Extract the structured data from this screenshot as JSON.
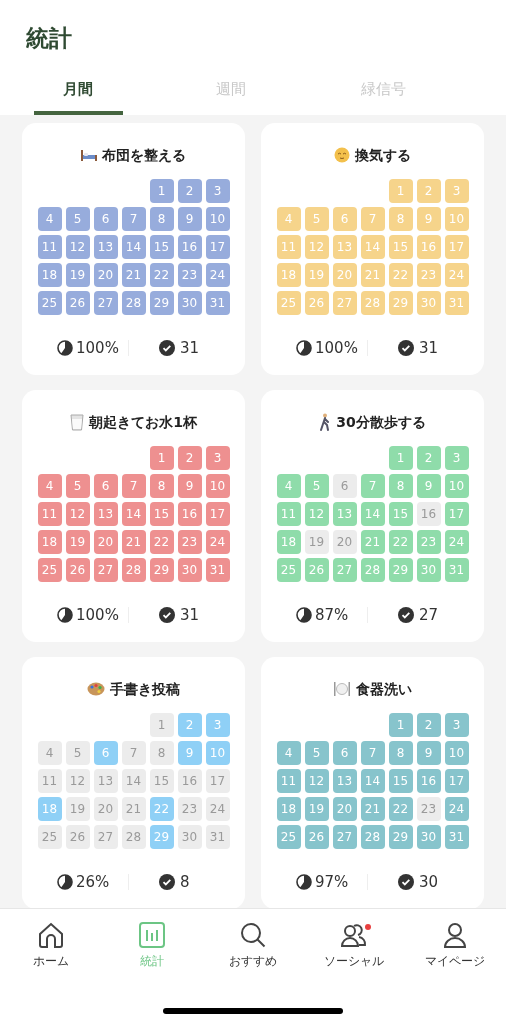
{
  "header": {
    "title": "統計"
  },
  "tabs": [
    {
      "label": "月間",
      "selected": true
    },
    {
      "label": "週間",
      "selected": false
    },
    {
      "label": "緑信号",
      "selected": false
    }
  ],
  "habits": [
    {
      "title": "布団を整える",
      "color": "#97acdc",
      "rate": "100%",
      "count": "31",
      "days": [
        {
          "label": "1",
          "done": true
        },
        {
          "label": "2",
          "done": true
        },
        {
          "label": "3",
          "done": true
        },
        {
          "label": "4",
          "done": true
        },
        {
          "label": "5",
          "done": true
        },
        {
          "label": "6",
          "done": true
        },
        {
          "label": "7",
          "done": true
        },
        {
          "label": "8",
          "done": true
        },
        {
          "label": "9",
          "done": true
        },
        {
          "label": "10",
          "done": true
        },
        {
          "label": "11",
          "done": true
        },
        {
          "label": "12",
          "done": true
        },
        {
          "label": "13",
          "done": true
        },
        {
          "label": "14",
          "done": true
        },
        {
          "label": "15",
          "done": true
        },
        {
          "label": "16",
          "done": true
        },
        {
          "label": "17",
          "done": true
        },
        {
          "label": "18",
          "done": true
        },
        {
          "label": "19",
          "done": true
        },
        {
          "label": "20",
          "done": true
        },
        {
          "label": "21",
          "done": true
        },
        {
          "label": "22",
          "done": true
        },
        {
          "label": "23",
          "done": true
        },
        {
          "label": "24",
          "done": true
        },
        {
          "label": "25",
          "done": true
        },
        {
          "label": "26",
          "done": true
        },
        {
          "label": "27",
          "done": true
        },
        {
          "label": "28",
          "done": true
        },
        {
          "label": "29",
          "done": true
        },
        {
          "label": "30",
          "done": true
        },
        {
          "label": "31",
          "done": true
        }
      ]
    },
    {
      "title": "換気する",
      "color": "#f6d48b",
      "rate": "100%",
      "count": "31",
      "days": [
        {
          "label": "1",
          "done": true
        },
        {
          "label": "2",
          "done": true
        },
        {
          "label": "3",
          "done": true
        },
        {
          "label": "4",
          "done": true
        },
        {
          "label": "5",
          "done": true
        },
        {
          "label": "6",
          "done": true
        },
        {
          "label": "7",
          "done": true
        },
        {
          "label": "8",
          "done": true
        },
        {
          "label": "9",
          "done": true
        },
        {
          "label": "10",
          "done": true
        },
        {
          "label": "11",
          "done": true
        },
        {
          "label": "12",
          "done": true
        },
        {
          "label": "13",
          "done": true
        },
        {
          "label": "14",
          "done": true
        },
        {
          "label": "15",
          "done": true
        },
        {
          "label": "16",
          "done": true
        },
        {
          "label": "17",
          "done": true
        },
        {
          "label": "18",
          "done": true
        },
        {
          "label": "19",
          "done": true
        },
        {
          "label": "20",
          "done": true
        },
        {
          "label": "21",
          "done": true
        },
        {
          "label": "22",
          "done": true
        },
        {
          "label": "23",
          "done": true
        },
        {
          "label": "24",
          "done": true
        },
        {
          "label": "25",
          "done": true
        },
        {
          "label": "26",
          "done": true
        },
        {
          "label": "27",
          "done": true
        },
        {
          "label": "28",
          "done": true
        },
        {
          "label": "29",
          "done": true
        },
        {
          "label": "30",
          "done": true
        },
        {
          "label": "31",
          "done": true
        }
      ]
    },
    {
      "title": "朝起きてお水1杯",
      "color": "#ee9090",
      "rate": "100%",
      "count": "31",
      "days": [
        {
          "label": "1",
          "done": true
        },
        {
          "label": "2",
          "done": true
        },
        {
          "label": "3",
          "done": true
        },
        {
          "label": "4",
          "done": true
        },
        {
          "label": "5",
          "done": true
        },
        {
          "label": "6",
          "done": true
        },
        {
          "label": "7",
          "done": true
        },
        {
          "label": "8",
          "done": true
        },
        {
          "label": "9",
          "done": true
        },
        {
          "label": "10",
          "done": true
        },
        {
          "label": "11",
          "done": true
        },
        {
          "label": "12",
          "done": true
        },
        {
          "label": "13",
          "done": true
        },
        {
          "label": "14",
          "done": true
        },
        {
          "label": "15",
          "done": true
        },
        {
          "label": "16",
          "done": true
        },
        {
          "label": "17",
          "done": true
        },
        {
          "label": "18",
          "done": true
        },
        {
          "label": "19",
          "done": true
        },
        {
          "label": "20",
          "done": true
        },
        {
          "label": "21",
          "done": true
        },
        {
          "label": "22",
          "done": true
        },
        {
          "label": "23",
          "done": true
        },
        {
          "label": "24",
          "done": true
        },
        {
          "label": "25",
          "done": true
        },
        {
          "label": "26",
          "done": true
        },
        {
          "label": "27",
          "done": true
        },
        {
          "label": "28",
          "done": true
        },
        {
          "label": "29",
          "done": true
        },
        {
          "label": "30",
          "done": true
        },
        {
          "label": "31",
          "done": true
        }
      ]
    },
    {
      "title": "30分散歩する",
      "color": "#8fdcaa",
      "rate": "87%",
      "count": "27",
      "days": [
        {
          "label": "1",
          "done": true
        },
        {
          "label": "2",
          "done": true
        },
        {
          "label": "3",
          "done": true
        },
        {
          "label": "4",
          "done": true
        },
        {
          "label": "5",
          "done": true
        },
        {
          "label": "6",
          "done": false
        },
        {
          "label": "7",
          "done": true
        },
        {
          "label": "8",
          "done": true
        },
        {
          "label": "9",
          "done": true
        },
        {
          "label": "10",
          "done": true
        },
        {
          "label": "11",
          "done": true
        },
        {
          "label": "12",
          "done": true
        },
        {
          "label": "13",
          "done": true
        },
        {
          "label": "14",
          "done": true
        },
        {
          "label": "15",
          "done": true
        },
        {
          "label": "16",
          "done": false
        },
        {
          "label": "17",
          "done": true
        },
        {
          "label": "18",
          "done": true
        },
        {
          "label": "19",
          "done": false
        },
        {
          "label": "20",
          "done": false
        },
        {
          "label": "21",
          "done": true
        },
        {
          "label": "22",
          "done": true
        },
        {
          "label": "23",
          "done": true
        },
        {
          "label": "24",
          "done": true
        },
        {
          "label": "25",
          "done": true
        },
        {
          "label": "26",
          "done": true
        },
        {
          "label": "27",
          "done": true
        },
        {
          "label": "28",
          "done": true
        },
        {
          "label": "29",
          "done": true
        },
        {
          "label": "30",
          "done": true
        },
        {
          "label": "31",
          "done": true
        }
      ]
    },
    {
      "title": "手書き投稿",
      "color": "#8fd0f6",
      "rate": "26%",
      "count": "8",
      "days": [
        {
          "label": "1",
          "done": false
        },
        {
          "label": "2",
          "done": true
        },
        {
          "label": "3",
          "done": true
        },
        {
          "label": "4",
          "done": false
        },
        {
          "label": "5",
          "done": false
        },
        {
          "label": "6",
          "done": true
        },
        {
          "label": "7",
          "done": false
        },
        {
          "label": "8",
          "done": false
        },
        {
          "label": "9",
          "done": true
        },
        {
          "label": "10",
          "done": true
        },
        {
          "label": "11",
          "done": false
        },
        {
          "label": "12",
          "done": false
        },
        {
          "label": "13",
          "done": false
        },
        {
          "label": "14",
          "done": false
        },
        {
          "label": "15",
          "done": false
        },
        {
          "label": "16",
          "done": false
        },
        {
          "label": "17",
          "done": false
        },
        {
          "label": "18",
          "done": true
        },
        {
          "label": "19",
          "done": false
        },
        {
          "label": "20",
          "done": false
        },
        {
          "label": "21",
          "done": false
        },
        {
          "label": "22",
          "done": true
        },
        {
          "label": "23",
          "done": false
        },
        {
          "label": "24",
          "done": false
        },
        {
          "label": "25",
          "done": false
        },
        {
          "label": "26",
          "done": false
        },
        {
          "label": "27",
          "done": false
        },
        {
          "label": "28",
          "done": false
        },
        {
          "label": "29",
          "done": true
        },
        {
          "label": "30",
          "done": false
        },
        {
          "label": "31",
          "done": false
        }
      ]
    },
    {
      "title": "食器洗い",
      "color": "#87c4cc",
      "rate": "97%",
      "count": "30",
      "days": [
        {
          "label": "1",
          "done": true
        },
        {
          "label": "2",
          "done": true
        },
        {
          "label": "3",
          "done": true
        },
        {
          "label": "4",
          "done": true
        },
        {
          "label": "5",
          "done": true
        },
        {
          "label": "6",
          "done": true
        },
        {
          "label": "7",
          "done": true
        },
        {
          "label": "8",
          "done": true
        },
        {
          "label": "9",
          "done": true
        },
        {
          "label": "10",
          "done": true
        },
        {
          "label": "11",
          "done": true
        },
        {
          "label": "12",
          "done": true
        },
        {
          "label": "13",
          "done": true
        },
        {
          "label": "14",
          "done": true
        },
        {
          "label": "15",
          "done": true
        },
        {
          "label": "16",
          "done": true
        },
        {
          "label": "17",
          "done": true
        },
        {
          "label": "18",
          "done": true
        },
        {
          "label": "19",
          "done": true
        },
        {
          "label": "20",
          "done": true
        },
        {
          "label": "21",
          "done": true
        },
        {
          "label": "22",
          "done": true
        },
        {
          "label": "23",
          "done": false
        },
        {
          "label": "24",
          "done": true
        },
        {
          "label": "25",
          "done": true
        },
        {
          "label": "26",
          "done": true
        },
        {
          "label": "27",
          "done": true
        },
        {
          "label": "28",
          "done": true
        },
        {
          "label": "29",
          "done": true
        },
        {
          "label": "30",
          "done": true
        },
        {
          "label": "31",
          "done": true
        }
      ]
    }
  ],
  "nav": [
    {
      "label": "ホーム",
      "selected": false,
      "badge": false
    },
    {
      "label": "統計",
      "selected": true,
      "badge": false
    },
    {
      "label": "おすすめ",
      "selected": false,
      "badge": false
    },
    {
      "label": "ソーシャル",
      "selected": false,
      "badge": true
    },
    {
      "label": "マイページ",
      "selected": false,
      "badge": false
    }
  ]
}
